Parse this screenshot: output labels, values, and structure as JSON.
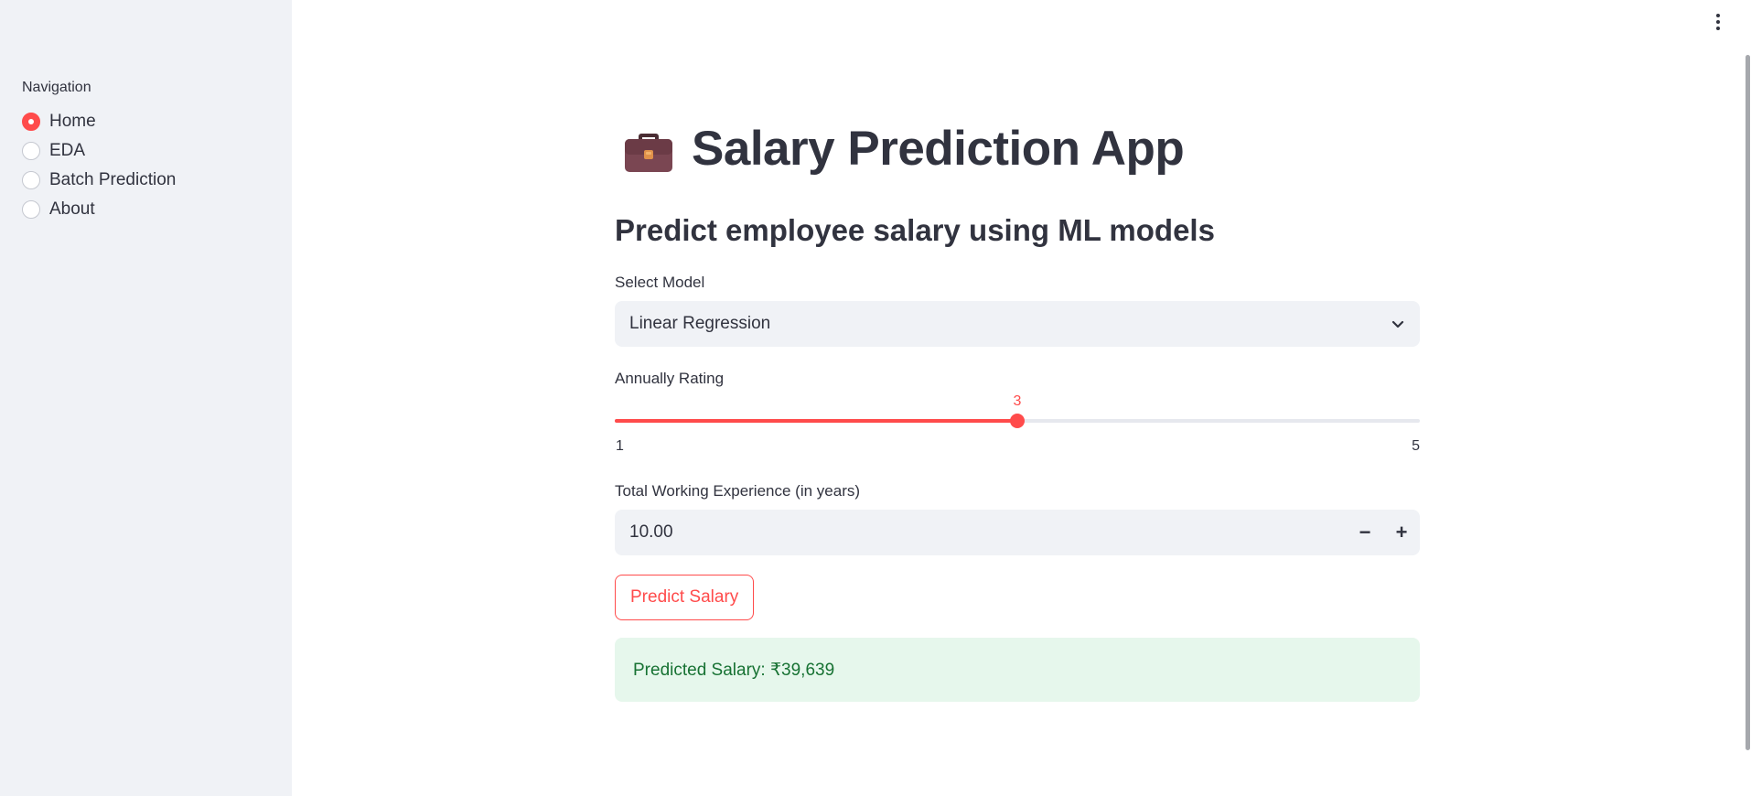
{
  "sidebar": {
    "heading": "Navigation",
    "items": [
      {
        "label": "Home",
        "selected": true
      },
      {
        "label": "EDA",
        "selected": false
      },
      {
        "label": "Batch Prediction",
        "selected": false
      },
      {
        "label": "About",
        "selected": false
      }
    ]
  },
  "header": {
    "title": "Salary Prediction App",
    "title_icon": "briefcase-icon",
    "subtitle": "Predict employee salary using ML models"
  },
  "model_select": {
    "label": "Select Model",
    "value": "Linear Regression"
  },
  "rating_slider": {
    "label": "Annually Rating",
    "value": 3,
    "min": 1,
    "max": 5
  },
  "experience_input": {
    "label": "Total Working Experience (in years)",
    "value": "10.00",
    "decrement": "−",
    "increment": "+"
  },
  "predict_button": {
    "label": "Predict Salary"
  },
  "result": {
    "text": "Predicted Salary: ₹39,639"
  },
  "colors": {
    "accent": "#ff4b4b",
    "sidebar_bg": "#f0f2f6",
    "success_bg": "#e6f7ec",
    "success_text": "#177233"
  }
}
